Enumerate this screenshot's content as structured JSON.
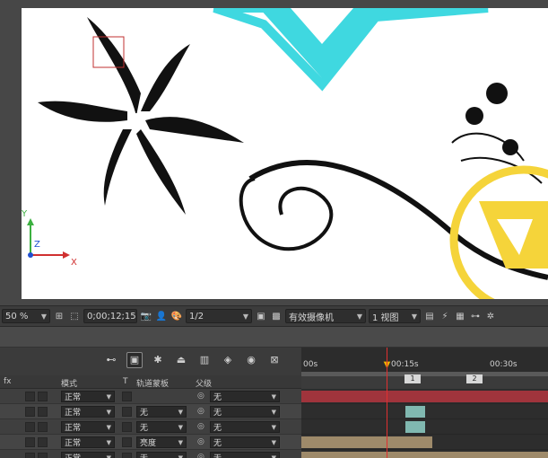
{
  "viewer": {
    "zoom": "50 %",
    "timecode": "0;00;12;15",
    "resolution": "1/2",
    "camera": "有效摄像机",
    "views": "1 视图",
    "axis_x": "X",
    "axis_y": "Y",
    "axis_z": "Z"
  },
  "timeline": {
    "time_labels": [
      "00s",
      "00:15s",
      "00:30s"
    ],
    "markers": [
      "1",
      "2"
    ],
    "headers": {
      "fx": "fx",
      "mode": "模式",
      "t": "T",
      "track_matte": "轨道蒙板",
      "parent": "父级"
    },
    "layers": [
      {
        "mode": "正常",
        "matte": "",
        "parent": "无",
        "bar_color": "#a0343c",
        "bar_start": 0.0,
        "bar_end": 1.0
      },
      {
        "mode": "正常",
        "matte": "无",
        "parent": "无",
        "bar_color": "#80b8b0",
        "bar_start": 0.42,
        "bar_end": 0.5
      },
      {
        "mode": "正常",
        "matte": "无",
        "parent": "无",
        "bar_color": "#80b8b0",
        "bar_start": 0.42,
        "bar_end": 0.5
      },
      {
        "mode": "正常",
        "matte": "亮度",
        "parent": "无",
        "bar_color": "#9e8a6a",
        "bar_start": 0.0,
        "bar_end": 0.53
      },
      {
        "mode": "正常",
        "matte": "无",
        "parent": "无",
        "bar_color": "#9e8a6a",
        "bar_start": 0.0,
        "bar_end": 1.0
      }
    ]
  },
  "colors": {
    "cyan_star": "#3fd8e0",
    "yellow_ring": "#f5d43a",
    "playhead": "#e03030"
  }
}
